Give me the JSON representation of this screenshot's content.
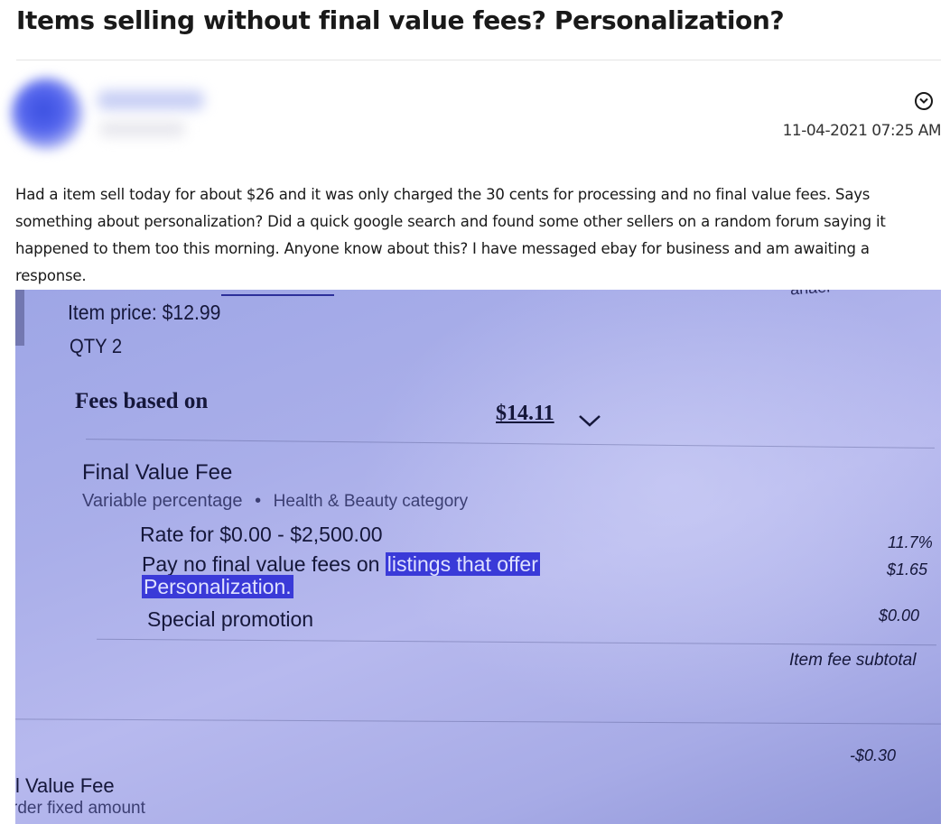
{
  "post": {
    "title": "Items selling without final value fees? Personalization?",
    "author": {
      "username": "xxxxxxxxxx",
      "stats": "xxxxxxxx"
    },
    "timestamp": "11-04-2021 07:25 AM",
    "body": "Had a item sell today for about $26 and it was only charged the 30 cents for processing and no final value fees. Says something about personalization? Did a quick google search and found some other sellers on a random forum saying it happened to them too this morning. Anyone know about this? I have messaged ebay for business and am awaiting a response."
  },
  "attachment": {
    "item_price": "Item price: $12.99",
    "qty": "QTY 2",
    "fees_based_on_label": "Fees based on",
    "fees_based_on_value": "$14.11",
    "final_value_fee": "Final Value Fee",
    "variable_percentage": "Variable percentage",
    "category": "Health & Beauty category",
    "rate_range": "Rate for $0.00 - $2,500.00",
    "rate_value": "11.7%",
    "pay_no_fee_prefix": "Pay no final value fees on",
    "pay_no_fee_link_1": "listings that offer",
    "pay_no_fee_link_2": "Personalization.",
    "pay_no_fee_value": "$1.65",
    "special_promotion": "Special promotion",
    "special_promotion_value": "$0.00",
    "item_fee_subtotal": "Item fee subtotal",
    "bottom_value": "-$0.30",
    "cut_label_1": "l Value Fee",
    "cut_label_2": "rder fixed amount",
    "cut_top_right": "anael"
  },
  "colors": {
    "highlight": "#3a3ad8",
    "photo_tint": "#a9aee9"
  },
  "icons": {
    "menu": "chevron-down-circle-icon",
    "fees_toggle": "chevron-down-icon"
  }
}
